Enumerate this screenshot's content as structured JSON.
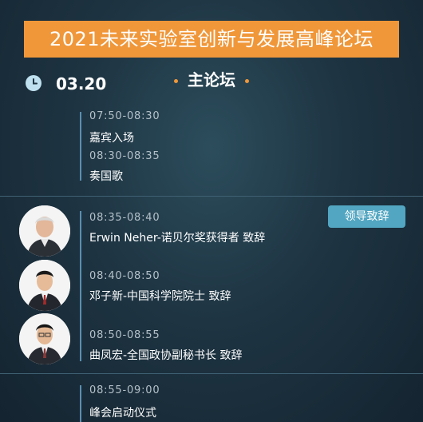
{
  "title": "2021未来实验室创新与发展高峰论坛",
  "date": "03.20",
  "forum_title": "主论坛",
  "tag": "领导致辞",
  "icons": {
    "clock": "clock-icon"
  },
  "colors": {
    "accent_orange": "#f0973a",
    "tag_blue": "#52a6c1",
    "line_blue": "#5b8fb0"
  },
  "agenda": [
    {
      "time": "07:50-08:30",
      "title": "嘉宾入场"
    },
    {
      "time": "08:30-08:35",
      "title": "奏国歌"
    },
    {
      "time": "08:35-08:40",
      "title": "Erwin Neher-诺贝尔奖获得者  致辞"
    },
    {
      "time": "08:40-08:50",
      "title": "邓子新-中国科学院院士  致辞"
    },
    {
      "time": "08:50-08:55",
      "title": "曲凤宏-全国政协副秘书长  致辞"
    },
    {
      "time": "08:55-09:00",
      "title": "峰会启动仪式"
    }
  ]
}
